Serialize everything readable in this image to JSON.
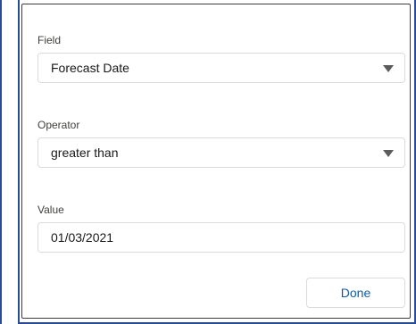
{
  "filter_popover": {
    "field": {
      "label": "Field",
      "selected": "Forecast Date"
    },
    "operator": {
      "label": "Operator",
      "selected": "greater than"
    },
    "value": {
      "label": "Value",
      "current": "01/03/2021"
    },
    "done_label": "Done"
  },
  "colors": {
    "border_accent": "#2a4a9a",
    "button_text": "#0b5cab",
    "input_border": "#dddbda"
  }
}
